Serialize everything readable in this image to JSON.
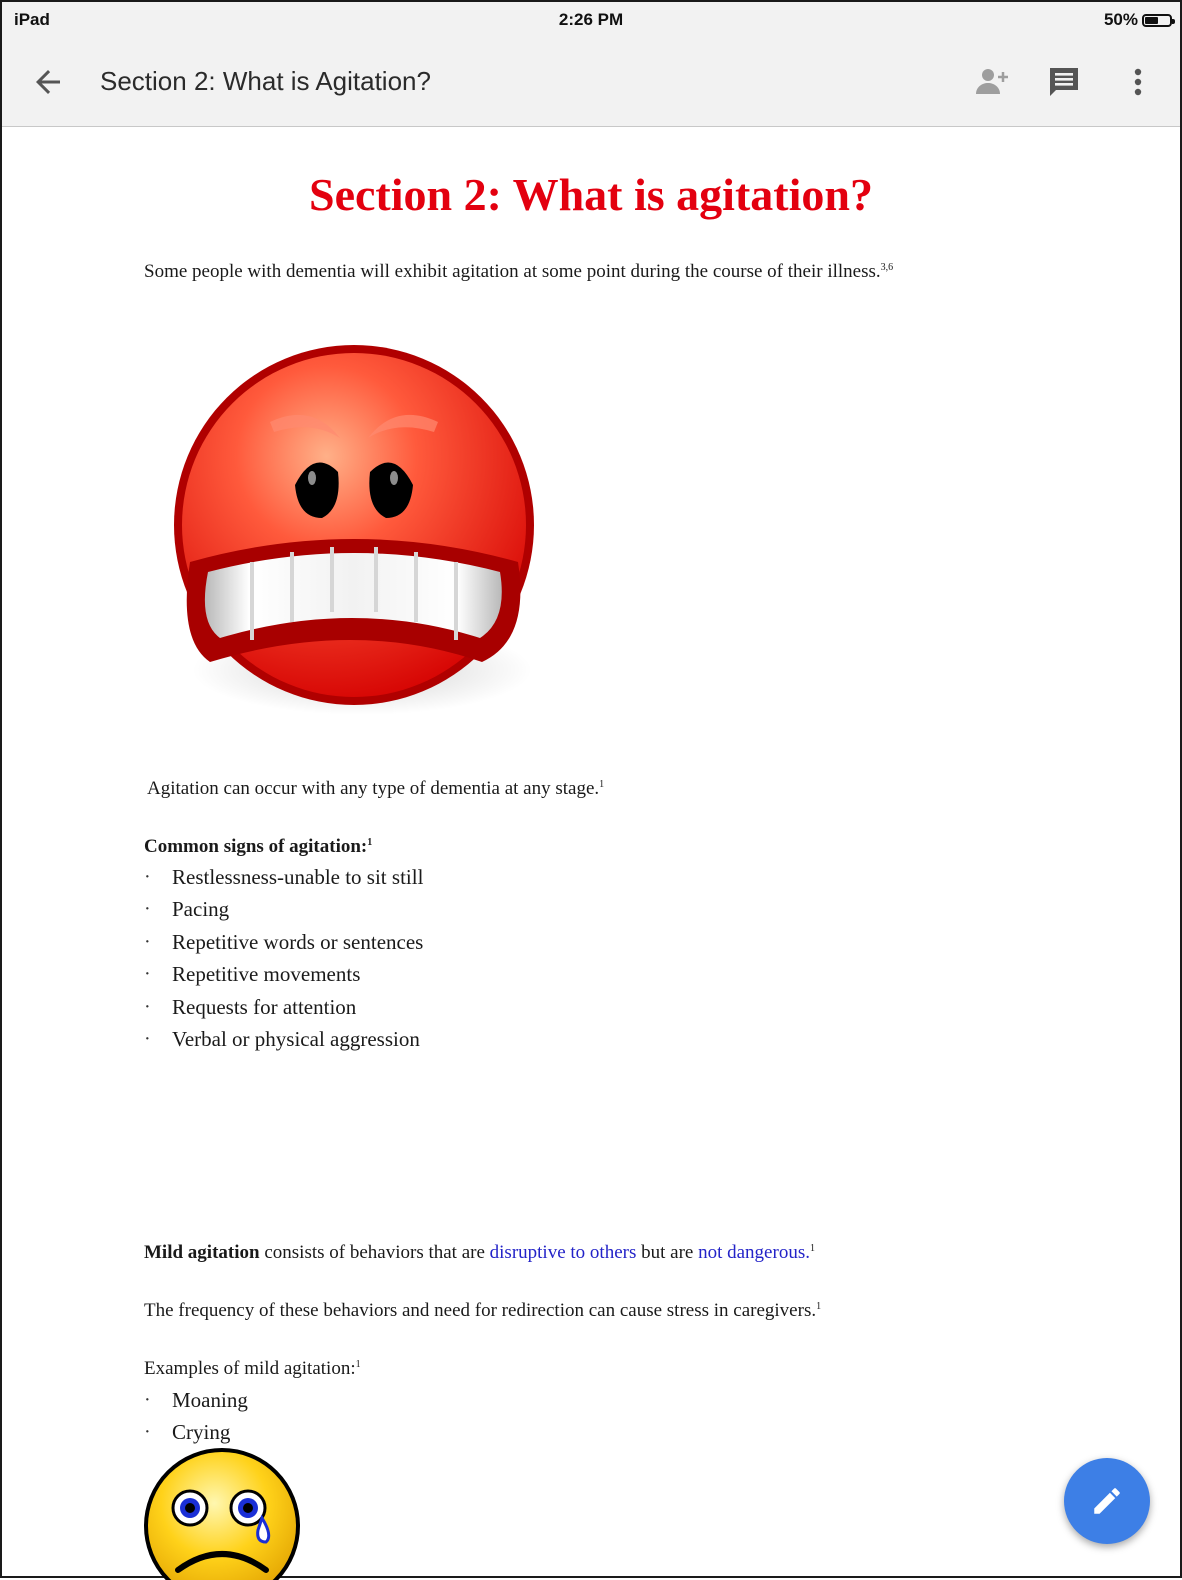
{
  "status_bar": {
    "device": "iPad",
    "time": "2:26 PM",
    "battery": "50%"
  },
  "toolbar": {
    "back_icon": "arrow-left-icon",
    "title": "Section 2: What is Agitation?",
    "add_person_icon": "person-add-icon",
    "comment_icon": "comment-icon",
    "more_icon": "more-vert-icon"
  },
  "document": {
    "heading": "Section 2: What is agitation?",
    "intro": {
      "text": "Some people with dementia will exhibit agitation at some point during the course of their illness.",
      "ref": "3,6"
    },
    "angry_image_icon": "angry-face-icon",
    "any_stage": {
      "text": "Agitation can occur with any type of dementia at any stage.",
      "ref": "1"
    },
    "signs_heading": {
      "text": "Common signs of agitation:",
      "ref": "1"
    },
    "signs": [
      "Restlessness-unable to sit still",
      "Pacing",
      "Repetitive words or sentences",
      "Repetitive movements",
      "Requests for attention",
      "Verbal or physical aggression"
    ],
    "mild": {
      "bold": "Mild agitation",
      "text1": " consists of behaviors that are ",
      "link1": "disruptive to others",
      "text2": " but are ",
      "link2": "not dangerous.",
      "ref": "1"
    },
    "frequency": {
      "text": "The frequency of these behaviors and need for redirection can cause stress in caregivers.",
      "ref": "1"
    },
    "examples_heading": {
      "text": "Examples of mild agitation:",
      "ref": "1"
    },
    "examples": [
      "Moaning",
      "Crying"
    ],
    "sad_image_icon": "crying-face-icon"
  },
  "fab": {
    "icon": "pencil-edit-icon",
    "color": "#3d7fe6"
  },
  "colors": {
    "heading": "#e3000f",
    "link": "#2323c8",
    "toolbar_bg": "#f2f2f2"
  }
}
